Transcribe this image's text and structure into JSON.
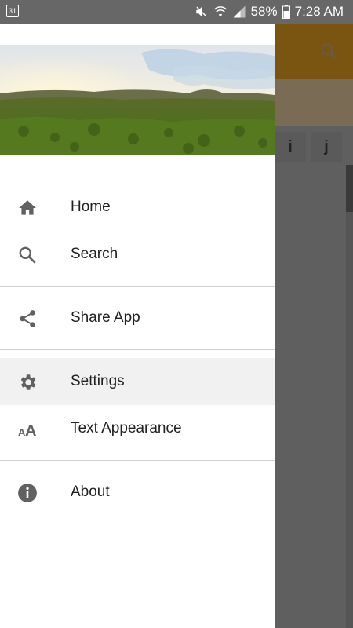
{
  "status_bar": {
    "calendar_day": "31",
    "battery": "58%",
    "time": "7:28 AM"
  },
  "background_app": {
    "tabs": [
      "i",
      "j"
    ],
    "toolbar_color": "#7a5511"
  },
  "drawer": {
    "sections": [
      {
        "items": [
          {
            "label": "Home",
            "icon": "home-icon"
          },
          {
            "label": "Search",
            "icon": "search-icon"
          }
        ]
      },
      {
        "items": [
          {
            "label": "Share App",
            "icon": "share-icon"
          }
        ]
      },
      {
        "items": [
          {
            "label": "Settings",
            "icon": "gear-icon",
            "active": true
          },
          {
            "label": "Text Appearance",
            "icon": "text-size-icon"
          }
        ]
      },
      {
        "items": [
          {
            "label": "About",
            "icon": "info-icon"
          }
        ]
      }
    ]
  }
}
